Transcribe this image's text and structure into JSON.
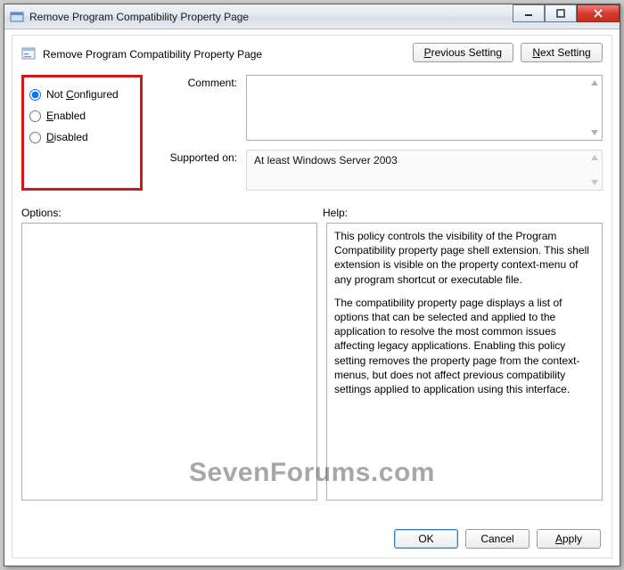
{
  "title": "Remove Program Compatibility Property Page",
  "header": {
    "title": "Remove Program Compatibility Property Page"
  },
  "nav": {
    "previous": "Previous Setting",
    "next": "Next Setting"
  },
  "radios": {
    "not_configured": "Not Configured",
    "enabled": "Enabled",
    "disabled": "Disabled",
    "selected": "not_configured"
  },
  "fields": {
    "comment_label": "Comment:",
    "comment_value": "",
    "supported_label": "Supported on:",
    "supported_value": "At least Windows Server 2003"
  },
  "lower": {
    "options_label": "Options:",
    "help_label": "Help:",
    "help_p1": "This policy controls the visibility of the Program Compatibility property page shell extension.  This shell extension is visible on the property context-menu of any program shortcut or executable file.",
    "help_p2": "The compatibility property page displays a list of options that can be selected and applied to the application to resolve the most common issues affecting legacy applications.  Enabling this policy setting removes the property page from the context-menus, but does not affect previous compatibility settings applied to application using this interface."
  },
  "buttons": {
    "ok": "OK",
    "cancel": "Cancel",
    "apply": "Apply"
  },
  "watermark": "SevenForums.com"
}
